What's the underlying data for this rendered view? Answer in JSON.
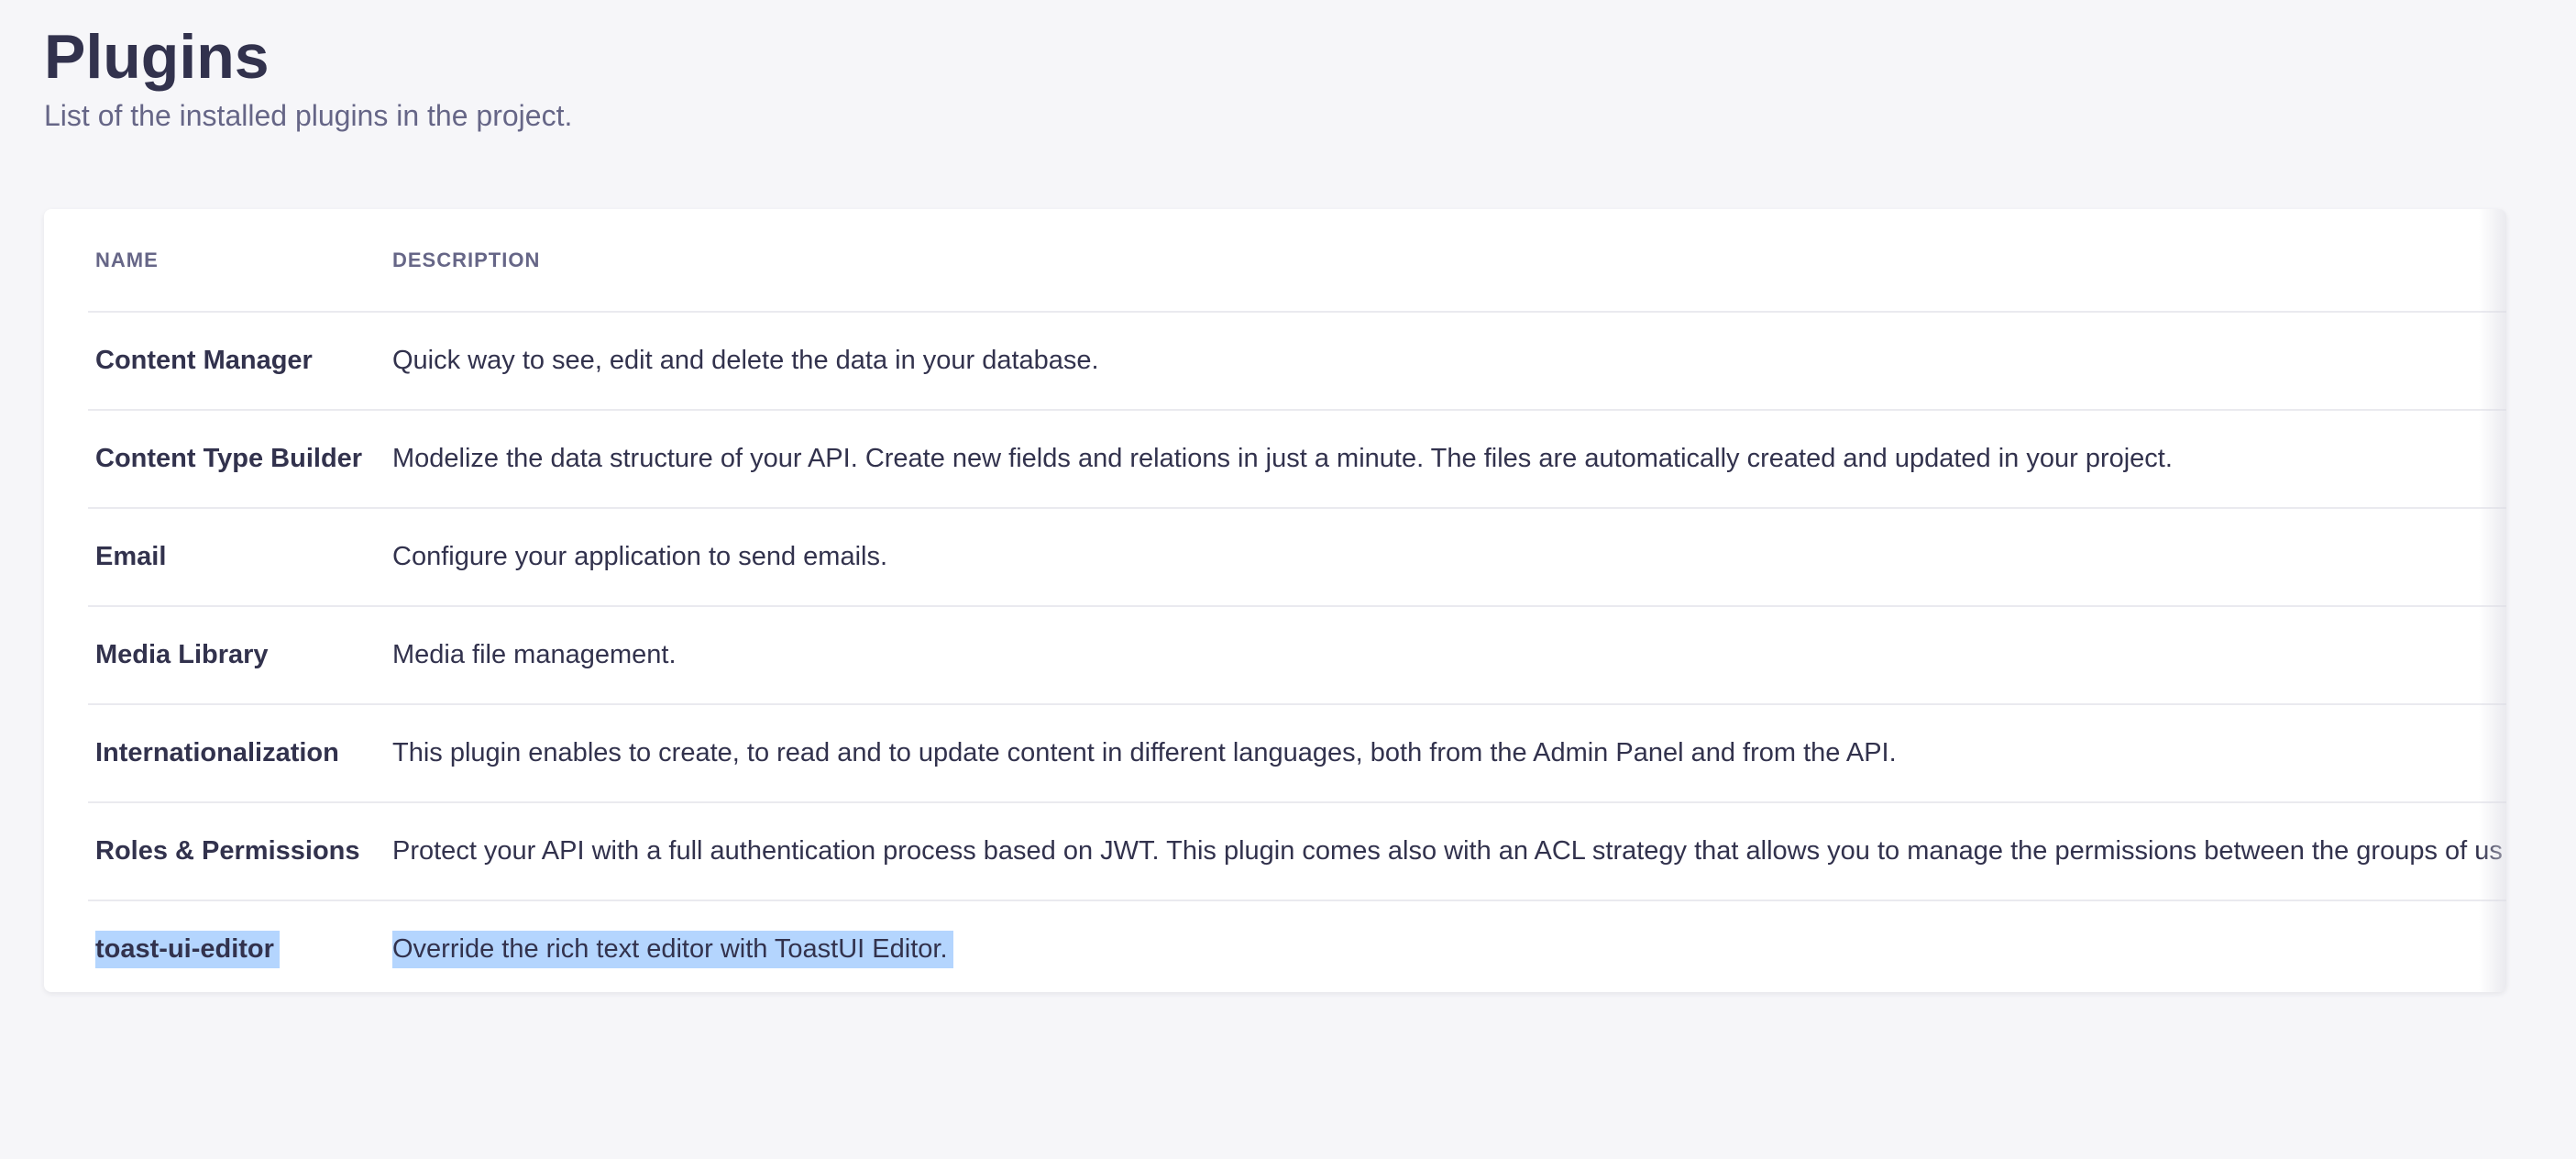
{
  "page": {
    "title": "Plugins",
    "subtitle": "List of the installed plugins in the project."
  },
  "table": {
    "headers": {
      "name": "NAME",
      "description": "DESCRIPTION"
    },
    "rows": [
      {
        "name": "Content Manager",
        "description": "Quick way to see, edit and delete the data in your database."
      },
      {
        "name": "Content Type Builder",
        "description": "Modelize the data structure of your API. Create new fields and relations in just a minute. The files are automatically created and updated in your project."
      },
      {
        "name": "Email",
        "description": "Configure your application to send emails."
      },
      {
        "name": "Media Library",
        "description": "Media file management."
      },
      {
        "name": "Internationalization",
        "description": "This plugin enables to create, to read and to update content in different languages, both from the Admin Panel and from the API."
      },
      {
        "name": "Roles & Permissions",
        "description": "Protect your API with a full authentication process based on JWT. This plugin comes also with an ACL strategy that allows you to manage the permissions between the groups of us"
      },
      {
        "name": "toast-ui-editor",
        "description": "Override the rich text editor with ToastUI Editor."
      }
    ]
  },
  "colors": {
    "background": "#f6f6f9",
    "text_primary": "#32324d",
    "text_secondary": "#666687",
    "selection": "#b4d5fe",
    "divider": "#eaeaef"
  }
}
